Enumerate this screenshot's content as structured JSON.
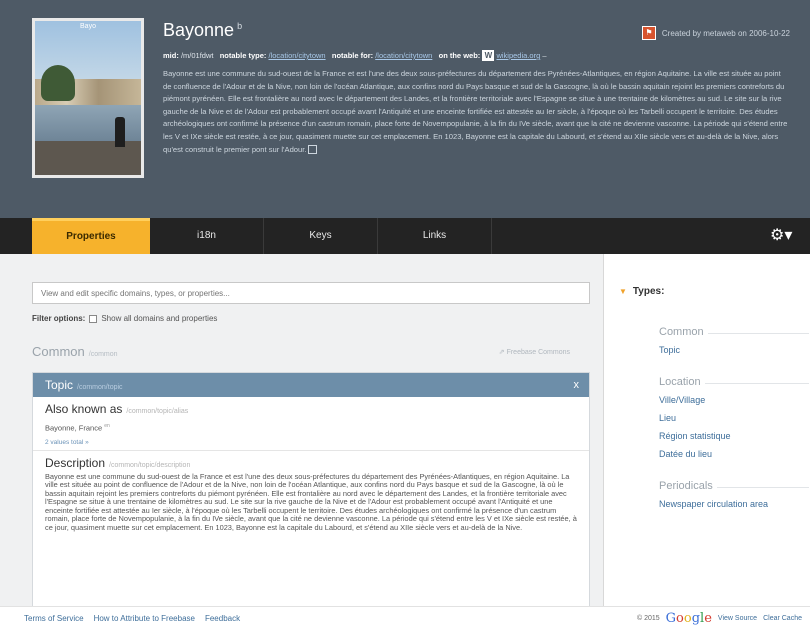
{
  "header": {
    "title": "Bayonne",
    "title_badge": "b",
    "thumb_caption": "Bayo",
    "flag_icon": "flag-icon",
    "created": "Created by metaweb on 2006-10-22",
    "meta": {
      "mid_label": "mid:",
      "mid_value": "/m/01fdwt",
      "notable_type_label": "notable type:",
      "notable_type_value": "/location/citytown",
      "notable_for_label": "notable for:",
      "notable_for_value": "/location/citytown",
      "web_label": "on the web:",
      "web_icon": "W",
      "web_value": "wikipedia.org",
      "web_more": "–"
    },
    "description": "Bayonne est une commune du sud-ouest de la France et est l'une des deux sous-préfectures du département des Pyrénées-Atlantiques, en région Aquitaine. La ville est située au point de confluence de l'Adour et de la Nive, non loin de l'océan Atlantique, aux confins nord du Pays basque et sud de la Gascogne, là où le bassin aquitain rejoint les premiers contreforts du piémont pyrénéen. Elle est frontalière au nord avec le département des Landes, et la frontière territoriale avec l'Espagne se situe à une trentaine de kilomètres au sud. Le site sur la rive gauche de la Nive et de l'Adour est probablement occupé avant l'Antiquité et une enceinte fortifiée est attestée au Ier siècle, à l'époque où les Tarbelli occupent le territoire. Des études archéologiques ont confirmé la présence d'un castrum romain, place forte de Novempopulanie, à la fin du IVe siècle, avant que la cité ne devienne vasconne. La période qui s'étend entre les V et IXe siècle est restée, à ce jour, quasiment muette sur cet emplacement. En 1023, Bayonne est la capitale du Labourd, et s'étend au XIIe siècle vers et au-delà de la Nive, alors qu'est construit le premier pont sur l'Adour."
  },
  "tabs": [
    {
      "label": "Properties"
    },
    {
      "label": "i18n"
    },
    {
      "label": "Keys"
    },
    {
      "label": "Links"
    }
  ],
  "gear_icon": "gear-icon",
  "main": {
    "search_placeholder": "View and edit specific domains, types, or properties...",
    "filter_label": "Filter options:",
    "filter_checkbox": "Show all domains and properties",
    "common_title": "Common",
    "common_path": "/common",
    "freebase_commons": "Freebase Commons",
    "topic_title": "Topic",
    "topic_path": "/common/topic",
    "topic_close": "x",
    "aka_title": "Also known as",
    "aka_path": "/common/topic/alias",
    "aka_value": "Bayonne, France",
    "aka_lang": "en",
    "values_total": "2 values total »",
    "desc_title": "Description",
    "desc_path": "/common/topic/description",
    "desc_text": "Bayonne est une commune du sud-ouest de la France et est l'une des deux sous-préfectures du département des Pyrénées-Atlantiques, en région Aquitaine. La ville est située au point de confluence de l'Adour et de la Nive, non loin de l'océan Atlantique, aux confins nord du Pays basque et sud de la Gascogne, là où le bassin aquitain rejoint les premiers contreforts du piémont pyrénéen. Elle est frontalière au nord avec le département des Landes, et la frontière territoriale avec l'Espagne se situe à une trentaine de kilomètres au sud. Le site sur la rive gauche de la Nive et de l'Adour est probablement occupé avant l'Antiquité et une enceinte fortifiée est attestée au Ier siècle, à l'époque où les Tarbelli occupent le territoire. Des études archéologiques ont confirmé la présence d'un castrum romain, place forte de Novempopulanie, à la fin du IVe siècle, avant que la cité ne devienne vasconne. La période qui s'étend entre les V et IXe siècle est restée, à ce jour, quasiment muette sur cet emplacement. En 1023, Bayonne est la capitale du Labourd, et s'étend au XIIe siècle vers et au-delà de la Nive."
  },
  "sidebar": {
    "types_label": "Types:",
    "groups": [
      {
        "label": "Common",
        "items": [
          "Topic"
        ]
      },
      {
        "label": "Location",
        "items": [
          "Ville/Village",
          "Lieu",
          "Région statistique",
          "Datée du lieu"
        ]
      },
      {
        "label": "Periodicals",
        "items": [
          "Newspaper circulation area"
        ]
      }
    ]
  },
  "footer": {
    "links": [
      "Terms of Service",
      "How to Attribute to Freebase",
      "Feedback"
    ],
    "copyright": "© 2015",
    "view_source": "View Source",
    "clear_cache": "Clear Cache"
  },
  "colors": {
    "header_bg": "#4e5a66",
    "tabbar_bg": "#232323",
    "active_tab": "#f6b22c",
    "topic_bar": "#6d8ea9",
    "link": "#3e6e9a"
  }
}
